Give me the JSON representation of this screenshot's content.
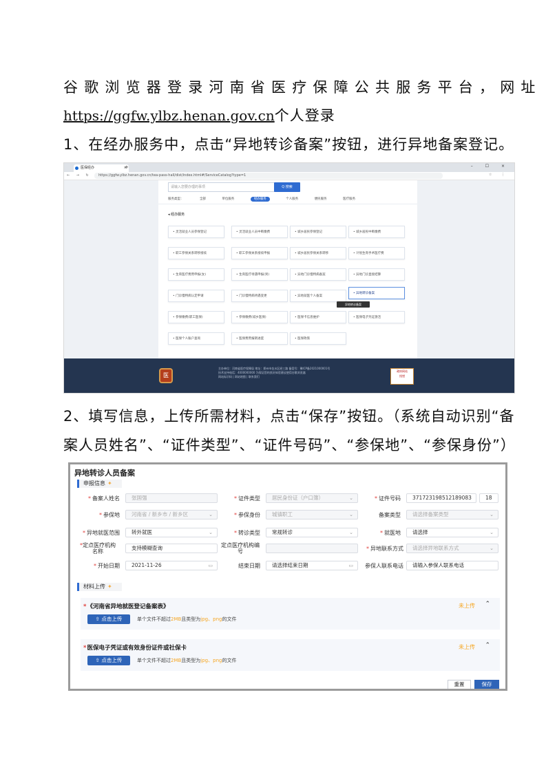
{
  "paragraphs": {
    "intro": "谷歌浏览器登录河南省医疗保障公共服务平台，网址",
    "url": "https://ggfw.ylbz.henan.gov.cn",
    "url_suffix": "个人登录",
    "step1": "1、在经办服务中，点击“异地转诊备案”按钮，进行异地备案登记。",
    "step2_line1": "2、填写信息，上传所需材料，点击“保存”按钮。（系统自动识别“备",
    "step2_line2": "案人员姓名”、“证件类型”、“证件号码”、“参保地”、“参保身份”）"
  },
  "browser": {
    "tab_title": "医保经办",
    "url": "https://ggfw.ylbz.henan.gov.cn/tea-pass-hall/dist/index.html#/ServiceCatalog?type=1",
    "search_placeholder": "请输入您要办理的事项",
    "search_button": "Q 搜索",
    "categories": [
      "服务类型：",
      "全部",
      "单位服务",
      "经办服务",
      "个人服务",
      "便民服务",
      "医疗服务"
    ],
    "active_category": "经办服务",
    "section_title": "经办服务",
    "services": [
      "灵活就业人员参保登记",
      "灵活就业人员中断缴费",
      "城乡居民参保登记",
      "城乡居民中断缴费",
      "职工参保关系转移接续",
      "职工参保关系接续申报",
      "城乡居民参保关系转移",
      "计划生育手术医疗费",
      "生育医疗费用申报(女)",
      "生育医疗待遇申报(男)",
      "异地门诊慢特病备案",
      "异地门诊直接结算",
      "门诊慢特病认定申请",
      "门诊慢特病待遇变更",
      "异地就医个人备案",
      "异地转诊备案",
      "参保缴费(职工医保)",
      "参保缴费(城乡医保)",
      "医保卡信息维护",
      "医保电子凭证激活",
      "医保个人账户查询",
      "医保费用报销进度",
      "医保政策"
    ],
    "highlighted_service": "异地转诊备案",
    "tooltip": "异地转诊备案",
    "footer": [
      "主办单位：河南省医疗保障局  地址：郑州市金水区经三路 备案号：豫ICP备2021000001号",
      "技术支持电话：4000000000  为保证您的良好体验建议使用谷歌浏览器",
      "网站标识码  |  网站地图  |  联系我们"
    ],
    "emblem_glyph": "医",
    "badge_lines": [
      "政府网站",
      "找错"
    ]
  },
  "form": {
    "title": "异地转诊人员备案",
    "section_apply": "申报信息",
    "fields": {
      "name_label": "备案人姓名",
      "name_value": "张国强",
      "idtype_label": "证件类型",
      "idtype_value": "居民身份证（户口簿）",
      "idno_label": "证件号码",
      "idno_value": "371723198512189083",
      "idno_extra": "18",
      "insured_place_label": "参保地",
      "insured_place_value": "河南省 / 新乡市 / 新乡区",
      "insured_identity_label": "参保身份",
      "insured_identity_value": "城镇职工",
      "filing_type_label": "备案类型",
      "filing_type_placeholder": "请选择备案类型",
      "medical_scope_label": "异地就医范围",
      "medical_scope_value": "转外就医",
      "referral_type_label": "转诊类型",
      "referral_type_value": "常规转诊",
      "medical_place_label": "就医地",
      "medical_place_placeholder": "请选择",
      "inst_name_label_1": "定点医疗机构",
      "inst_name_label_2": "名称",
      "inst_name_placeholder": "支持模糊查询",
      "inst_code_label_1": "定点医疗机构编",
      "inst_code_label_2": "号",
      "contact_method_label": "异地联系方式",
      "contact_method_placeholder": "请选择异地联系方式",
      "start_date_label": "开始日期",
      "start_date_value": "2021-11-26",
      "end_date_label": "结束日期",
      "end_date_placeholder": "请选择结束日期",
      "contact_phone_label": "参保人联系电话",
      "contact_phone_placeholder": "请输入参保人联系电话"
    },
    "section_upload": "材料上传",
    "uploads": [
      {
        "title": "《河南省异地就医登记备案表》",
        "status": "未上传",
        "button": "点击上传",
        "hint_pre": "单个文件不超过",
        "hint_size": "2MB",
        "hint_mid": "且类型为",
        "hint_types": "jpg、png",
        "hint_post": "的文件"
      },
      {
        "title": "医保电子凭证或有效身份证件或社保卡",
        "status": "未上传",
        "button": "点击上传",
        "hint_pre": "单个文件不超过",
        "hint_size": "2MB",
        "hint_mid": "且类型为",
        "hint_types": "jpg、png",
        "hint_post": "的文件"
      }
    ],
    "reset_button": "重置",
    "save_button": "保存"
  },
  "colors": {
    "accent": "#2e64b8",
    "warning": "#f5a623",
    "required": "#e0403d",
    "footer": "#243550"
  }
}
